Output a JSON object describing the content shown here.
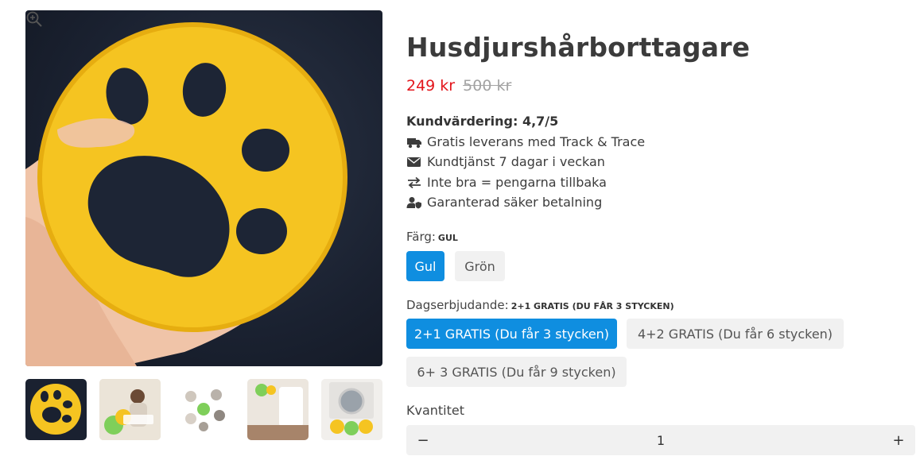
{
  "gallery": {
    "main_image_alt": "Yellow paw-shaped pet hair remover held in hand",
    "thumbnails": [
      {
        "name": "thumb-yellow-paw"
      },
      {
        "name": "thumb-woman-laundry"
      },
      {
        "name": "thumb-infographic"
      },
      {
        "name": "thumb-green-paw-laundry"
      },
      {
        "name": "thumb-washing-machine"
      }
    ]
  },
  "product": {
    "title": "Husdjurshårborttagare",
    "price_now": "249 kr",
    "price_was": "500 kr",
    "rating": "Kundvärdering: 4,7/5",
    "features": [
      {
        "icon": "truck-icon",
        "text": "Gratis leverans med Track & Trace"
      },
      {
        "icon": "envelope-icon",
        "text": "Kundtjänst 7 dagar i veckan"
      },
      {
        "icon": "exchange-icon",
        "text": "Inte bra = pengarna tillbaka"
      },
      {
        "icon": "user-shield-icon",
        "text": "Garanterad säker betalning"
      }
    ]
  },
  "color_option": {
    "label": "Färg:",
    "selected": "GUL",
    "choices": [
      "Gul",
      "Grön"
    ]
  },
  "deal_option": {
    "label": "Dagserbjudande:",
    "selected": "2+1 GRATIS (DU FÅR 3 STYCKEN)",
    "choices": [
      "2+1 GRATIS (Du får 3 stycken)",
      "4+2 GRATIS (Du får 6 stycken)",
      "6+ 3 GRATIS (Du får 9 stycken)"
    ]
  },
  "quantity": {
    "label": "Kvantitet",
    "value": "1",
    "minus": "−",
    "plus": "+"
  },
  "colors": {
    "accent": "#0f8ee0",
    "sale_price": "#e3161c",
    "product_yellow": "#f6c623"
  }
}
